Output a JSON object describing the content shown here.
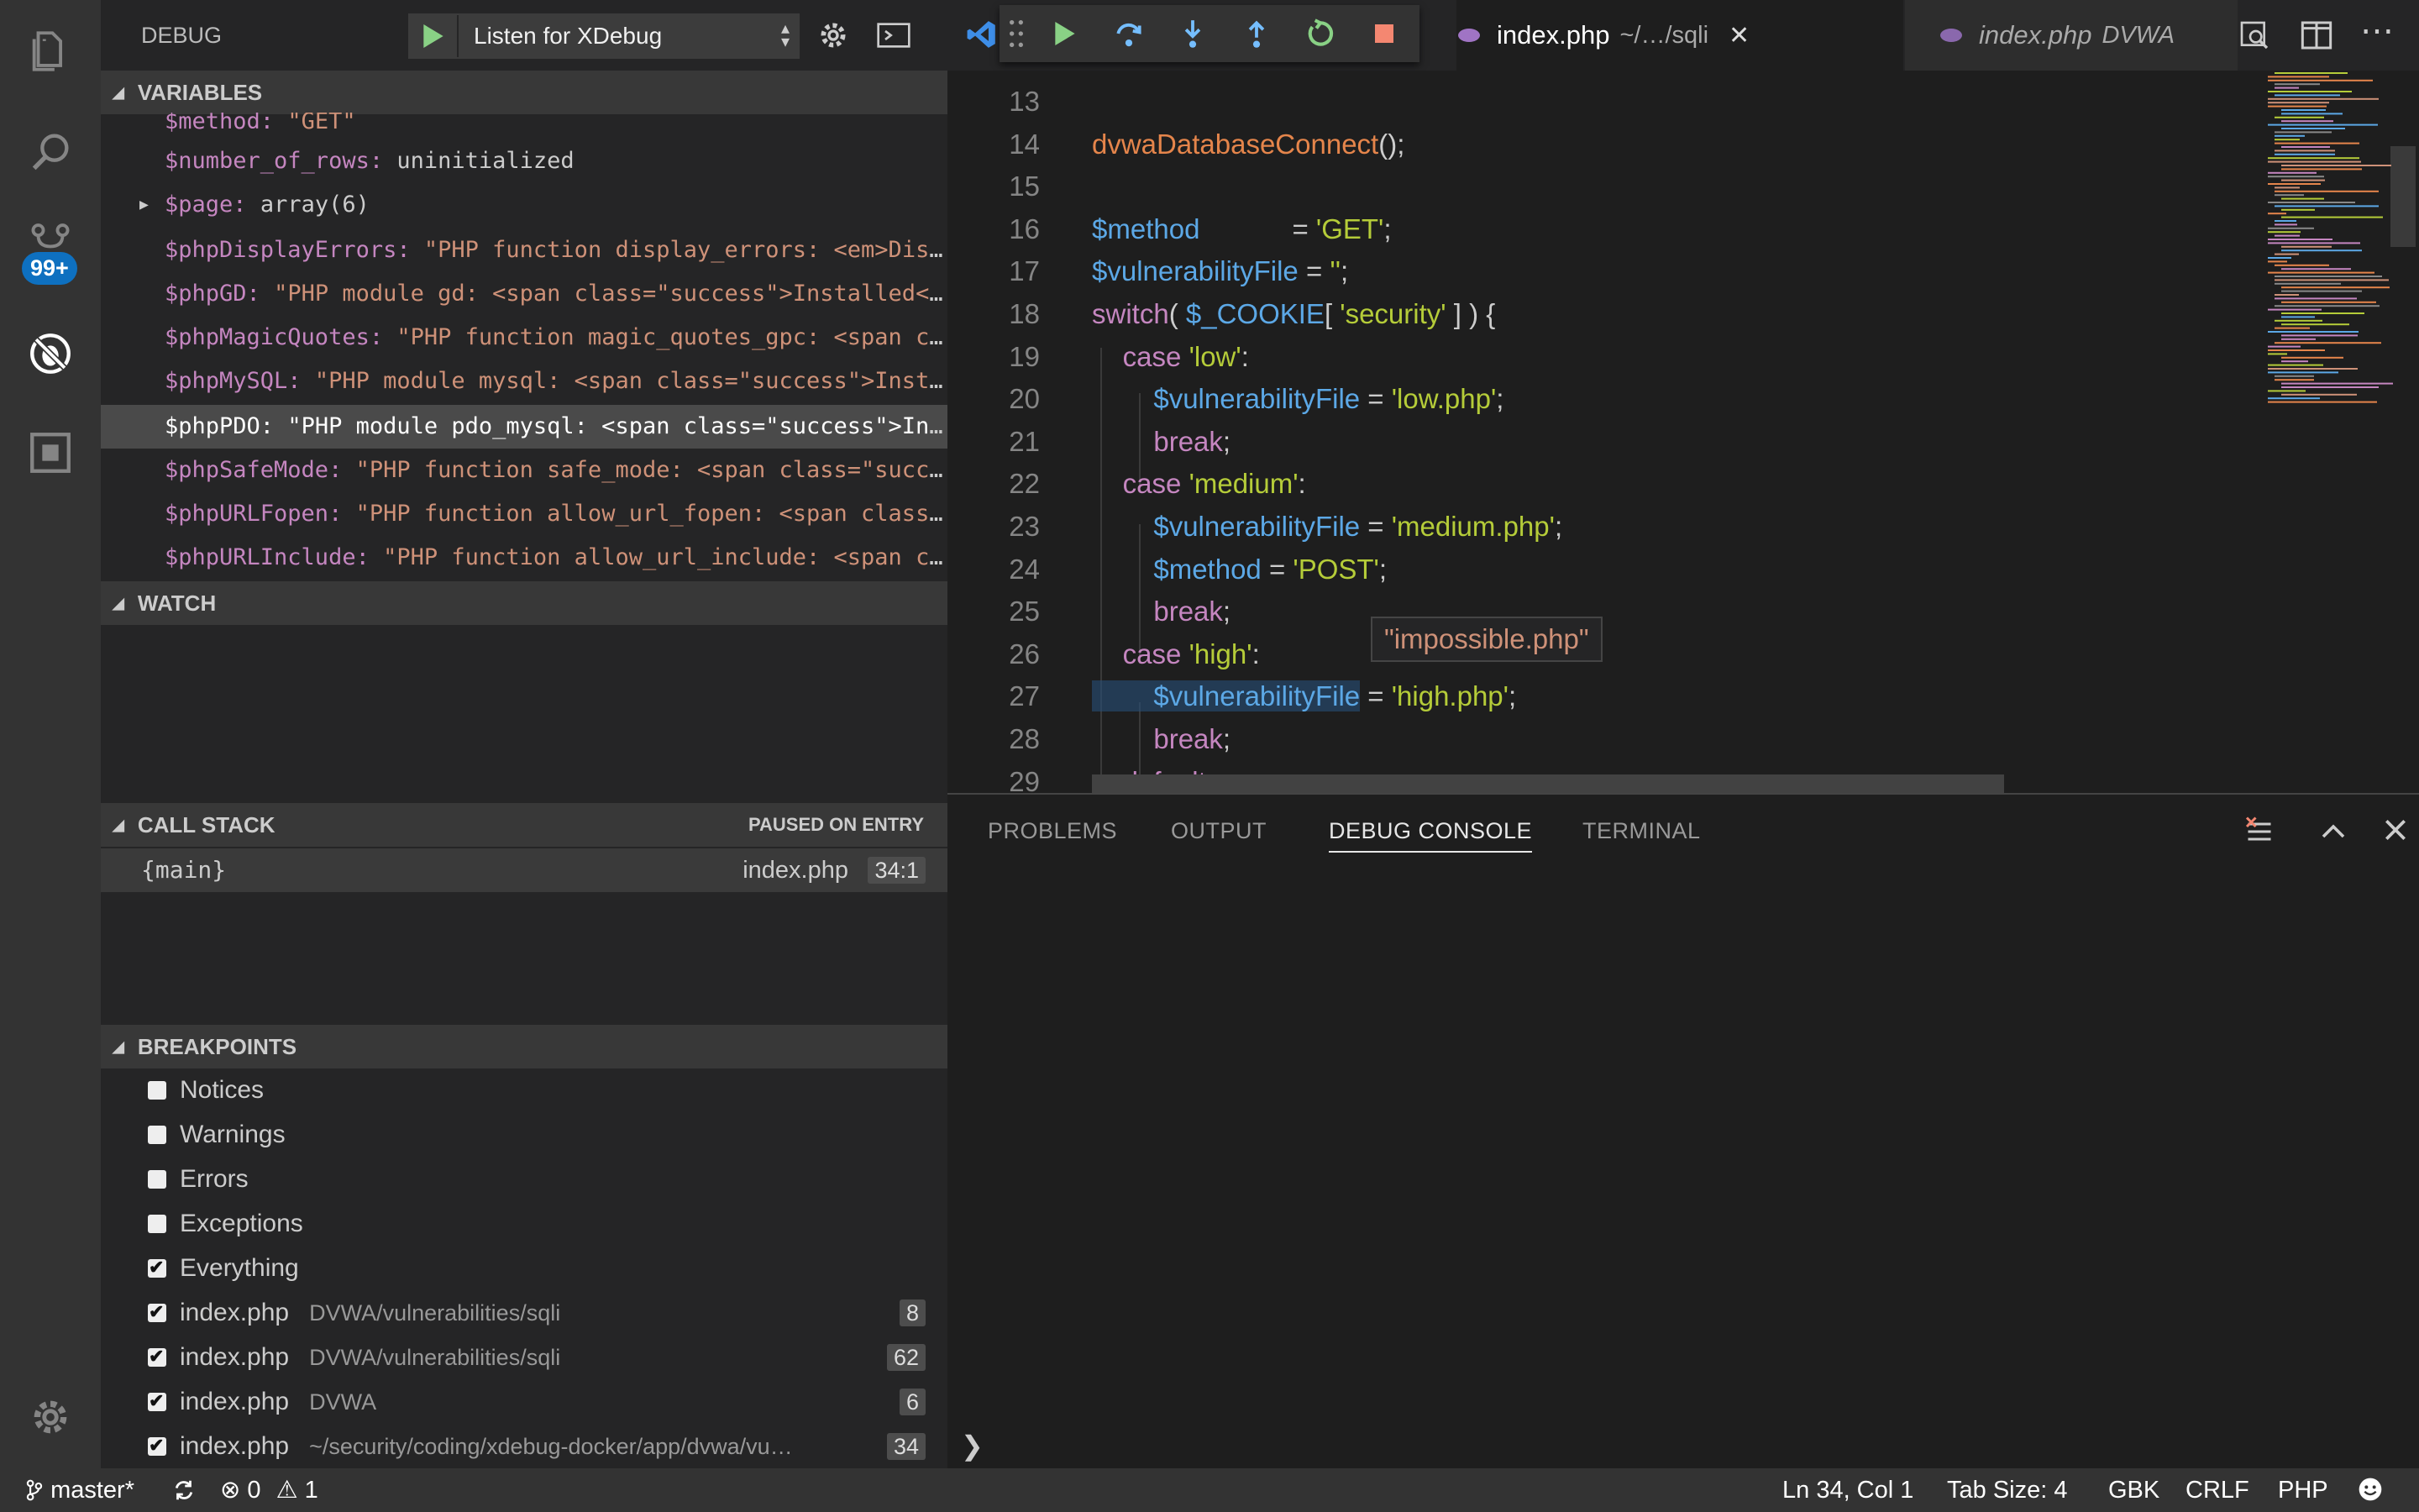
{
  "activity": {
    "badge": "99+",
    "icons": [
      "files-icon",
      "search-icon",
      "source-control-icon",
      "debug-icon",
      "extensions-icon",
      "gear-icon"
    ]
  },
  "debug": {
    "title": "DEBUG",
    "launch_config": "Listen for XDebug"
  },
  "variables": {
    "header": "VARIABLES",
    "rows": [
      {
        "name": "$method:",
        "value": "\"GET\"",
        "type": "string"
      },
      {
        "name": "$number_of_rows:",
        "value": "uninitialized",
        "type": "plain"
      },
      {
        "name": "$page:",
        "value": "array(6)",
        "type": "plain"
      },
      {
        "name": "$phpDisplayErrors:",
        "value": "\"PHP function display_errors: <em>Disab…",
        "type": "string"
      },
      {
        "name": "$phpGD:",
        "value": "\"PHP module gd: <span class=\"success\">Installed</s…",
        "type": "string"
      },
      {
        "name": "$phpMagicQuotes:",
        "value": "\"PHP function magic_quotes_gpc: <span cla…",
        "type": "string"
      },
      {
        "name": "$phpMySQL:",
        "value": "\"PHP module mysql: <span class=\"success\">Instal…",
        "type": "string"
      },
      {
        "name": "$phpPDO:",
        "value": "\"PHP module pdo_mysql: <span class=\"success\">Inst…",
        "type": "string"
      },
      {
        "name": "$phpSafeMode:",
        "value": "\"PHP function safe_mode: <span class=\"succes…",
        "type": "string"
      },
      {
        "name": "$phpURLFopen:",
        "value": "\"PHP function allow_url_fopen: <span class=\"…",
        "type": "string"
      },
      {
        "name": "$phpURLInclude:",
        "value": "\"PHP function allow_url_include: <span cla…",
        "type": "string"
      }
    ]
  },
  "watch": {
    "header": "WATCH"
  },
  "callstack": {
    "header": "CALL STACK",
    "status": "PAUSED ON ENTRY",
    "frame": "{main}",
    "file": "index.php",
    "position": "34:1"
  },
  "breakpoints": {
    "header": "BREAKPOINTS",
    "items": [
      {
        "label": "Notices",
        "path": "",
        "line": "",
        "checked": false
      },
      {
        "label": "Warnings",
        "path": "",
        "line": "",
        "checked": false
      },
      {
        "label": "Errors",
        "path": "",
        "line": "",
        "checked": false
      },
      {
        "label": "Exceptions",
        "path": "",
        "line": "",
        "checked": false
      },
      {
        "label": "Everything",
        "path": "",
        "line": "",
        "checked": true
      },
      {
        "label": "index.php",
        "path": "DVWA/vulnerabilities/sqli",
        "line": "8",
        "checked": true
      },
      {
        "label": "index.php",
        "path": "DVWA/vulnerabilities/sqli",
        "line": "62",
        "checked": true
      },
      {
        "label": "index.php",
        "path": "DVWA",
        "line": "6",
        "checked": true
      },
      {
        "label": "index.php",
        "path": "~/security/coding/xdebug-docker/app/dvwa/vu…",
        "line": "34",
        "checked": true
      }
    ]
  },
  "tabs": [
    {
      "name": "index.php",
      "desc": "~/…/sqli",
      "close": "✕"
    },
    {
      "name": "index.php",
      "desc": "DVWA"
    }
  ],
  "code": {
    "lines": [
      {
        "n": "13",
        "tokens": []
      },
      {
        "n": "14",
        "tokens": [
          {
            "t": "dvwaDatabaseConnect",
            "c": "fn"
          },
          {
            "t": "();",
            "c": "p"
          }
        ]
      },
      {
        "n": "15",
        "tokens": []
      },
      {
        "n": "16",
        "tokens": [
          {
            "t": "$method",
            "c": "var"
          },
          {
            "t": "            = ",
            "c": "p"
          },
          {
            "t": "'GET'",
            "c": "str"
          },
          {
            "t": ";",
            "c": "p"
          }
        ]
      },
      {
        "n": "17",
        "tokens": [
          {
            "t": "$vulnerabilityFile",
            "c": "var"
          },
          {
            "t": " = ",
            "c": "p"
          },
          {
            "t": "''",
            "c": "str"
          },
          {
            "t": ";",
            "c": "p"
          }
        ]
      },
      {
        "n": "18",
        "tokens": [
          {
            "t": "switch",
            "c": "kw"
          },
          {
            "t": "( ",
            "c": "p"
          },
          {
            "t": "$_COOKIE",
            "c": "var"
          },
          {
            "t": "[ ",
            "c": "p"
          },
          {
            "t": "'security'",
            "c": "str"
          },
          {
            "t": " ] ) {",
            "c": "p"
          }
        ]
      },
      {
        "n": "19",
        "tokens": [
          {
            "t": "    case ",
            "c": "kw"
          },
          {
            "t": "'low'",
            "c": "str"
          },
          {
            "t": ":",
            "c": "p"
          }
        ]
      },
      {
        "n": "20",
        "tokens": [
          {
            "t": "        $vulnerabilityFile",
            "c": "var"
          },
          {
            "t": " = ",
            "c": "p"
          },
          {
            "t": "'low.php'",
            "c": "str"
          },
          {
            "t": ";",
            "c": "p"
          }
        ]
      },
      {
        "n": "21",
        "tokens": [
          {
            "t": "        break",
            "c": "kw"
          },
          {
            "t": ";",
            "c": "p"
          }
        ]
      },
      {
        "n": "22",
        "tokens": [
          {
            "t": "    case ",
            "c": "kw"
          },
          {
            "t": "'medium'",
            "c": "str"
          },
          {
            "t": ":",
            "c": "p"
          }
        ]
      },
      {
        "n": "23",
        "tokens": [
          {
            "t": "        $vulnerabilityFile",
            "c": "var"
          },
          {
            "t": " = ",
            "c": "p"
          },
          {
            "t": "'medium.php'",
            "c": "str"
          },
          {
            "t": ";",
            "c": "p"
          }
        ]
      },
      {
        "n": "24",
        "tokens": [
          {
            "t": "        $method",
            "c": "var"
          },
          {
            "t": " = ",
            "c": "p"
          },
          {
            "t": "'POST'",
            "c": "str"
          },
          {
            "t": ";",
            "c": "p"
          }
        ]
      },
      {
        "n": "25",
        "tokens": [
          {
            "t": "        break",
            "c": "kw"
          },
          {
            "t": ";",
            "c": "p"
          }
        ]
      },
      {
        "n": "26",
        "tokens": [
          {
            "t": "    case ",
            "c": "kw"
          },
          {
            "t": "'high'",
            "c": "str"
          },
          {
            "t": ":",
            "c": "p"
          }
        ]
      },
      {
        "n": "27",
        "tokens": [
          {
            "t": "        $vulnerabilityFile",
            "c": "var"
          },
          {
            "t": " = ",
            "c": "p"
          },
          {
            "t": "'high.php'",
            "c": "str"
          },
          {
            "t": ";",
            "c": "p"
          }
        ]
      },
      {
        "n": "28",
        "tokens": [
          {
            "t": "        break",
            "c": "kw"
          },
          {
            "t": ";",
            "c": "p"
          }
        ]
      },
      {
        "n": "29",
        "tokens": [
          {
            "t": "    default",
            "c": "kw"
          },
          {
            "t": ":",
            "c": "p"
          }
        ]
      }
    ],
    "hover": "\"impossible.php\""
  },
  "panel": {
    "tabs": [
      "PROBLEMS",
      "OUTPUT",
      "DEBUG CONSOLE",
      "TERMINAL"
    ],
    "active": "DEBUG CONSOLE",
    "prompt": "❯"
  },
  "status": {
    "branch": "master*",
    "errors": "0",
    "warnings": "1",
    "position": "Ln 34, Col 1",
    "tab_size": "Tab Size: 4",
    "encoding": "GBK",
    "eol": "CRLF",
    "language": "PHP"
  },
  "colors": {
    "accent": "#0e70c0",
    "continue": "#89d185",
    "stop": "#f48771",
    "step": "#75beff"
  }
}
